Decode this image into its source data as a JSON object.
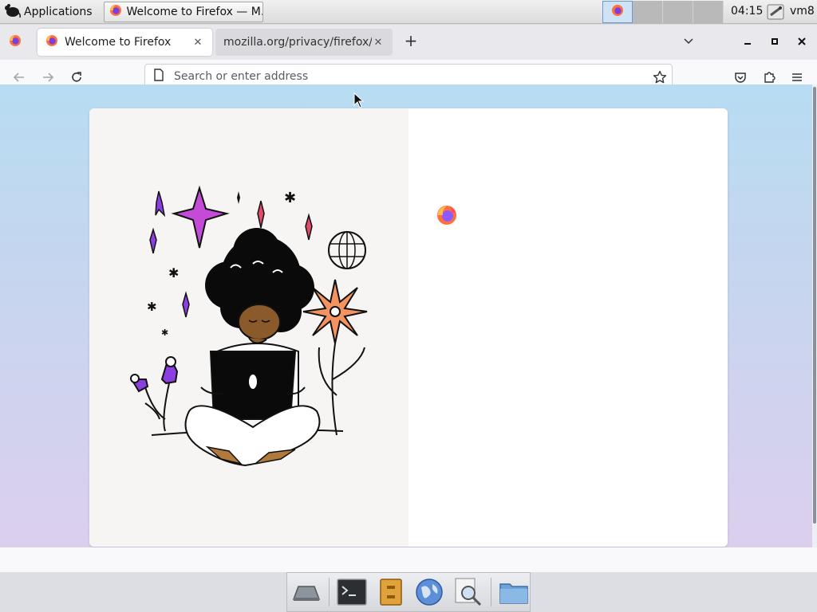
{
  "panel": {
    "applications_label": "Applications",
    "task_title": "Welcome to Firefox — M...",
    "clock": "04:15",
    "user": "vm8"
  },
  "browser": {
    "tabs": [
      {
        "label": "Welcome to Firefox",
        "active": true
      },
      {
        "label": "mozilla.org/privacy/firefox/",
        "active": false
      }
    ],
    "url_placeholder": "Search or enter address"
  },
  "dock": {
    "items": [
      "show-desktop-icon",
      "terminal-icon",
      "file-cabinet-icon",
      "web-browser-icon",
      "search-icon",
      "folder-icon"
    ]
  },
  "colors": {
    "content_gradient_top": "#b7dcf2",
    "content_gradient_bottom": "#dccfee",
    "firefox_orange": "#ff7139",
    "firefox_purple": "#9059ff"
  }
}
